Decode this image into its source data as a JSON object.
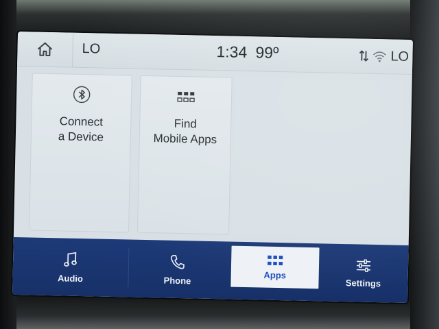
{
  "status_bar": {
    "home_icon": "home-icon",
    "temp_left": "LO",
    "time": "1:34",
    "outside_temp": "99º",
    "signal_icon": "data-transfer-icon",
    "wifi_icon": "wifi-icon",
    "temp_right": "LO"
  },
  "tiles": [
    {
      "icon": "bluetooth-icon",
      "line1": "Connect",
      "line2": "a Device"
    },
    {
      "icon": "app-grid-icon",
      "line1": "Find",
      "line2": "Mobile Apps"
    }
  ],
  "nav": {
    "selected": "Apps",
    "items": [
      {
        "label": "Audio",
        "icon": "music-note-icon"
      },
      {
        "label": "Phone",
        "icon": "phone-icon"
      },
      {
        "label": "Apps",
        "icon": "app-grid-icon"
      },
      {
        "label": "Settings",
        "icon": "sliders-icon"
      }
    ]
  },
  "colors": {
    "screen_bg": "#d8e0e5",
    "nav_bg": "#1d3a78",
    "nav_selected_bg": "#eef2f6",
    "nav_selected_text": "#1e4fbd"
  }
}
